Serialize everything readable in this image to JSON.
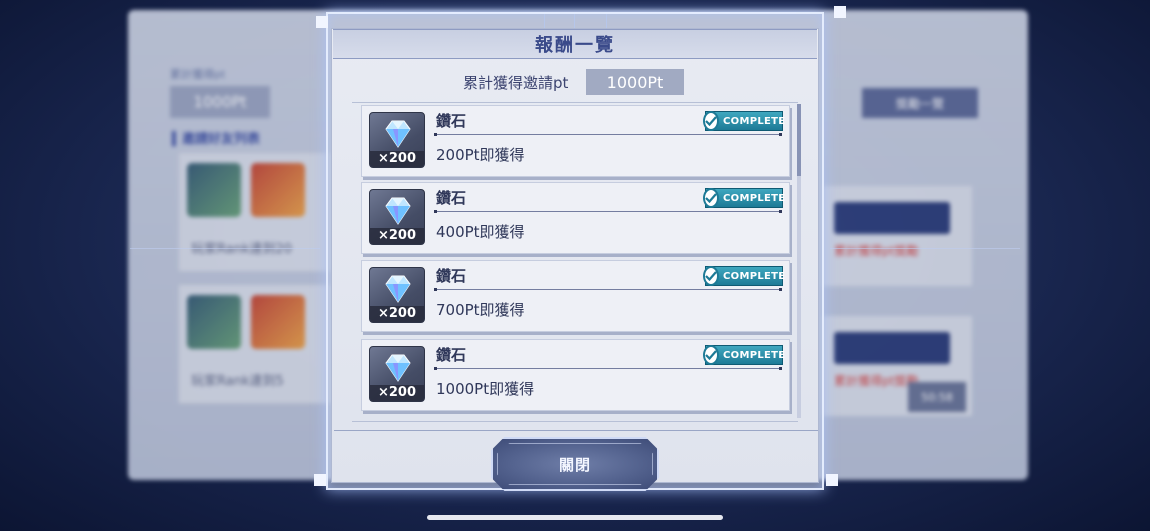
{
  "background": {
    "label_small": "累計獲得pt",
    "pt_value": "1000Pt",
    "section_title": "▍邀請好友列表",
    "cards": [
      {
        "text": "玩家Rank達到20"
      },
      {
        "text": "玩家Rank達到5"
      }
    ],
    "right_button": "獎勵一覽",
    "red_text": "累計獲得pt獎勵",
    "time": "50:58"
  },
  "modal": {
    "title": "報酬一覽",
    "pt_label": "累計獲得邀請pt",
    "pt_value": "1000Pt",
    "rewards": [
      {
        "name": "鑽石",
        "quantity": "×200",
        "condition": "200Pt即獲得",
        "status": "COMPLETE"
      },
      {
        "name": "鑽石",
        "quantity": "×200",
        "condition": "400Pt即獲得",
        "status": "COMPLETE"
      },
      {
        "name": "鑽石",
        "quantity": "×200",
        "condition": "700Pt即獲得",
        "status": "COMPLETE"
      },
      {
        "name": "鑽石",
        "quantity": "×200",
        "condition": "1000Pt即獲得",
        "status": "COMPLETE"
      }
    ],
    "close_label": "關閉"
  },
  "icons": {
    "reward_item": "diamond-icon",
    "complete": "check-circle-icon"
  },
  "colors": {
    "title_text": "#3a4a8a",
    "complete_badge": "#1d7a96",
    "close_button": "#54638f"
  }
}
